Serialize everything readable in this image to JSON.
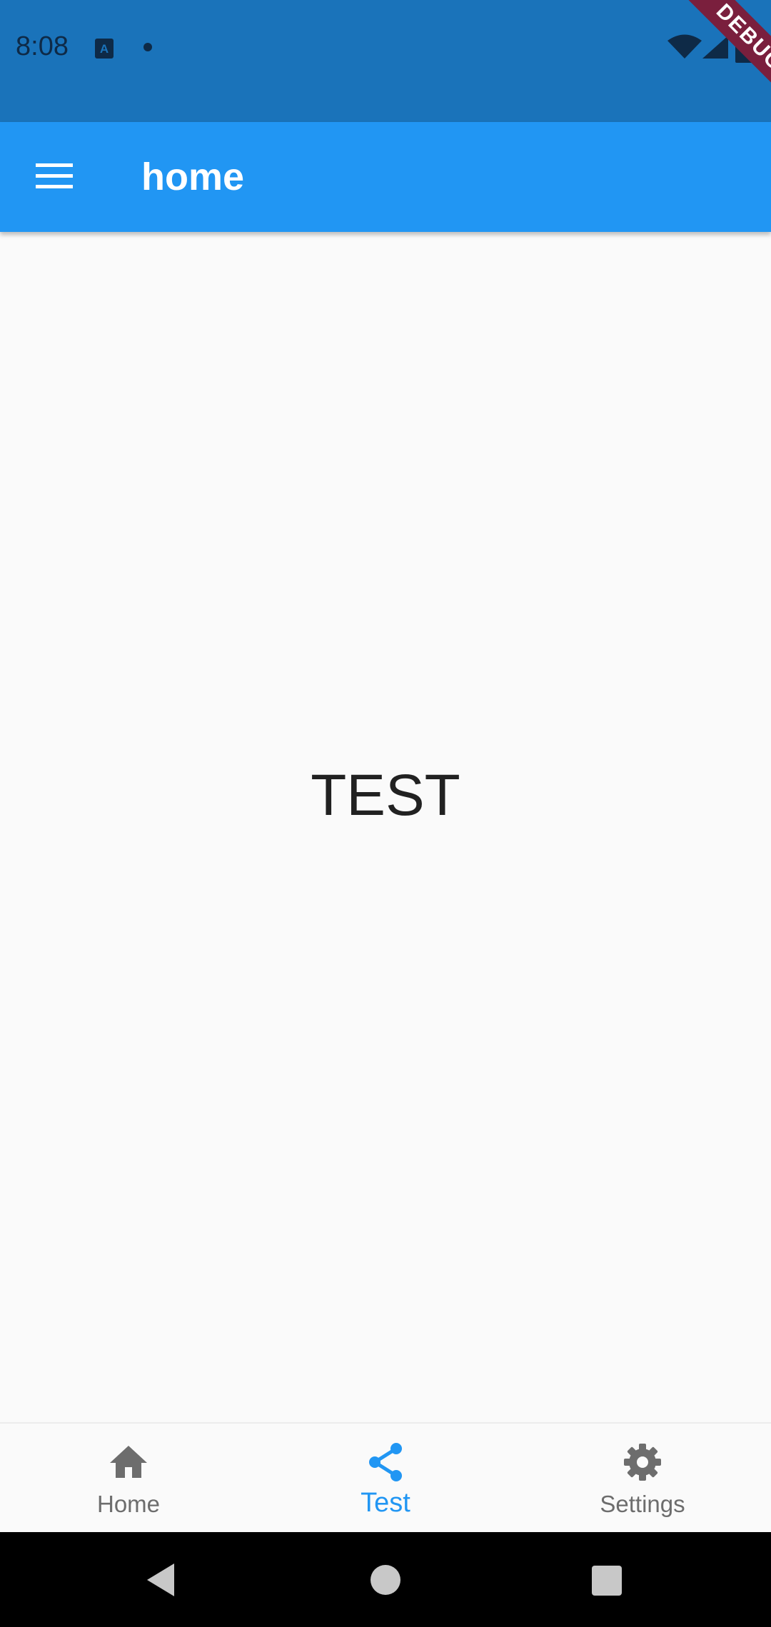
{
  "status_bar": {
    "time": "8:08",
    "background_color": "#1a73ba",
    "icons": [
      "text-recognition-icon",
      "notification-dot-icon",
      "wifi-icon",
      "cell-signal-icon",
      "battery-icon"
    ]
  },
  "debug_banner": {
    "label": "DEBUG",
    "color": "#7a1f3d"
  },
  "app_bar": {
    "title": "home",
    "menu_icon": "hamburger-menu-icon",
    "background_color": "#2196f3"
  },
  "main": {
    "center_text": "TEST"
  },
  "bottom_nav": {
    "active_color": "#2196f3",
    "inactive_color": "#6d6d6d",
    "items": [
      {
        "label": "Home",
        "icon": "home-icon",
        "active": false
      },
      {
        "label": "Test",
        "icon": "share-icon",
        "active": true
      },
      {
        "label": "Settings",
        "icon": "gear-icon",
        "active": false
      }
    ]
  },
  "system_nav": {
    "buttons": [
      "back-icon",
      "home-circle-icon",
      "recents-square-icon"
    ]
  }
}
